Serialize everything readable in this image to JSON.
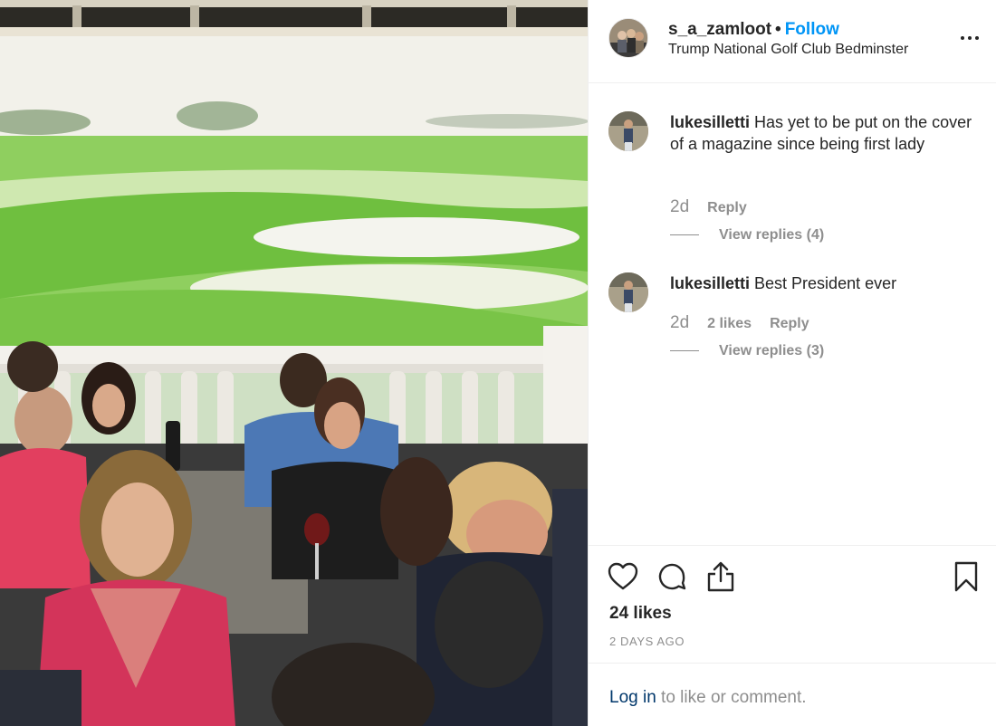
{
  "post": {
    "username": "s_a_zamloot",
    "separator": "•",
    "follow_label": "Follow",
    "location": "Trump National Golf Club Bedminster",
    "likes": "24 likes",
    "date": "2 DAYS AGO"
  },
  "comments": [
    {
      "username": "lukesilletti",
      "text": "Has yet to be put on the cover of a magazine since being first lady",
      "age": "2d",
      "likes": "",
      "reply_label": "Reply",
      "view_replies": "View replies (4)"
    },
    {
      "username": "lukesilletti",
      "text": "Best President ever",
      "age": "2d",
      "likes": "2 likes",
      "reply_label": "Reply",
      "view_replies": "View replies (3)"
    }
  ],
  "footer": {
    "login_link": "Log in",
    "login_suffix": " to like or comment."
  },
  "icons": {
    "more": "more-options-icon",
    "like": "heart-icon",
    "comment": "comment-icon",
    "share": "share-icon",
    "save": "bookmark-icon"
  },
  "colors": {
    "link_blue": "#0095f6",
    "text_dark": "#262626",
    "text_muted": "#8e8e8e",
    "login_link": "#00376b",
    "divider": "#efefef"
  }
}
